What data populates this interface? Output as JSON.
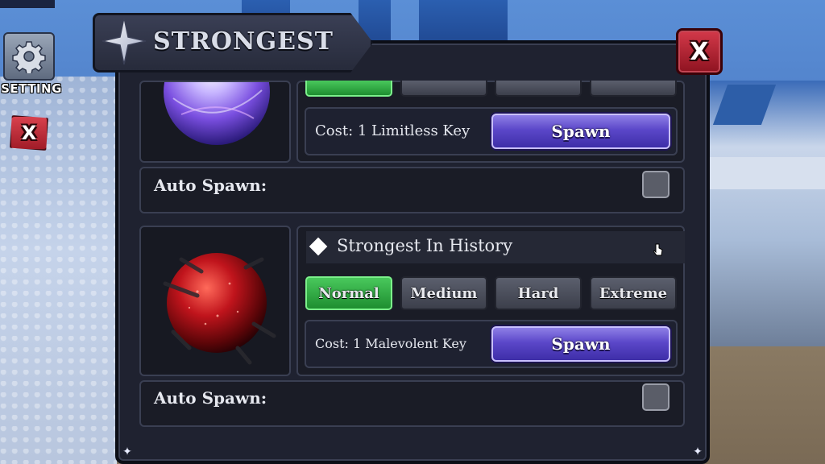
{
  "panel": {
    "title": "STRONGEST",
    "close_label": "X"
  },
  "hud": {
    "setting_label": "SETTING",
    "close_label": "X"
  },
  "bosses": [
    {
      "orb_color": "#9b7cff",
      "cost": "Cost: 1 Limitless Key",
      "spawn_label": "Spawn",
      "auto_spawn_label": "Auto Spawn:",
      "auto_spawn": false
    },
    {
      "name": "Strongest In History",
      "orb_color": "#c0141c",
      "difficulties": [
        "Normal",
        "Medium",
        "Hard",
        "Extreme"
      ],
      "selected_difficulty": "Normal",
      "cost": "Cost: 1 Malevolent Key",
      "spawn_label": "Spawn",
      "auto_spawn_label": "Auto Spawn:",
      "auto_spawn": false
    }
  ],
  "colors": {
    "accent_green": "#2fae43",
    "spawn_purple": "#5b47c9",
    "close_red": "#b8232f"
  }
}
